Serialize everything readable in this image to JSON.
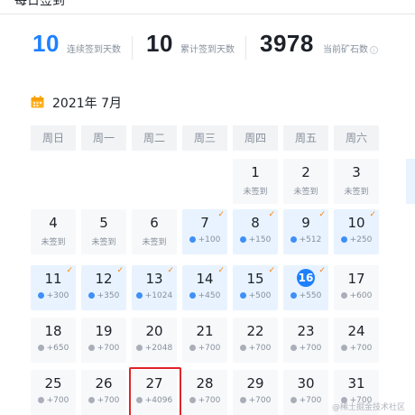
{
  "header": {
    "title": "每日签到"
  },
  "stats": [
    {
      "value": "10",
      "label": "连续签到天数",
      "color": "#1e80ff"
    },
    {
      "value": "10",
      "label": "累计签到天数",
      "color": "#1d2129"
    },
    {
      "value": "3978",
      "label": "当前矿石数",
      "color": "#1d2129",
      "info_icon": "info-icon"
    }
  ],
  "calendar": {
    "month_label": "2021年 7月",
    "icon": "calendar-icon",
    "weekdays": [
      "周日",
      "周一",
      "周二",
      "周三",
      "周四",
      "周五",
      "周六"
    ],
    "days": [
      {
        "day": "1",
        "status": "未签到",
        "signed": false
      },
      {
        "day": "2",
        "status": "未签到",
        "signed": false
      },
      {
        "day": "3",
        "status": "未签到",
        "signed": false
      },
      {
        "day": "4",
        "status": "未签到",
        "signed": false
      },
      {
        "day": "5",
        "status": "未签到",
        "signed": false
      },
      {
        "day": "6",
        "status": "未签到",
        "signed": false
      },
      {
        "day": "7",
        "reward": "+100",
        "signed": true
      },
      {
        "day": "8",
        "reward": "+150",
        "signed": true
      },
      {
        "day": "9",
        "reward": "+512",
        "signed": true
      },
      {
        "day": "10",
        "reward": "+250",
        "signed": true
      },
      {
        "day": "11",
        "reward": "+300",
        "signed": true
      },
      {
        "day": "12",
        "reward": "+350",
        "signed": true
      },
      {
        "day": "13",
        "reward": "+1024",
        "signed": true
      },
      {
        "day": "14",
        "reward": "+450",
        "signed": true
      },
      {
        "day": "15",
        "reward": "+500",
        "signed": true
      },
      {
        "day": "16",
        "reward": "+550",
        "signed": true,
        "today": true
      },
      {
        "day": "17",
        "reward": "+600",
        "signed": false
      },
      {
        "day": "18",
        "reward": "+650",
        "signed": false
      },
      {
        "day": "19",
        "reward": "+700",
        "signed": false
      },
      {
        "day": "20",
        "reward": "+2048",
        "signed": false
      },
      {
        "day": "21",
        "reward": "+700",
        "signed": false
      },
      {
        "day": "22",
        "reward": "+700",
        "signed": false
      },
      {
        "day": "23",
        "reward": "+700",
        "signed": false
      },
      {
        "day": "24",
        "reward": "+700",
        "signed": false
      },
      {
        "day": "25",
        "reward": "+700",
        "signed": false
      },
      {
        "day": "26",
        "reward": "+700",
        "signed": false
      },
      {
        "day": "27",
        "reward": "+4096",
        "signed": false,
        "highlighted": true
      },
      {
        "day": "28",
        "reward": "+700",
        "signed": false
      },
      {
        "day": "29",
        "reward": "+700",
        "signed": false
      },
      {
        "day": "30",
        "reward": "+700",
        "signed": false
      },
      {
        "day": "31",
        "reward": "+700",
        "signed": false
      }
    ],
    "first_weekday_index": 4
  },
  "watermark": "@稀土掘金技术社区",
  "colors": {
    "accent": "#1e80ff",
    "signed_bg": "#e8f3ff",
    "check": "#ff7d00",
    "highlight": "#e0242a"
  }
}
